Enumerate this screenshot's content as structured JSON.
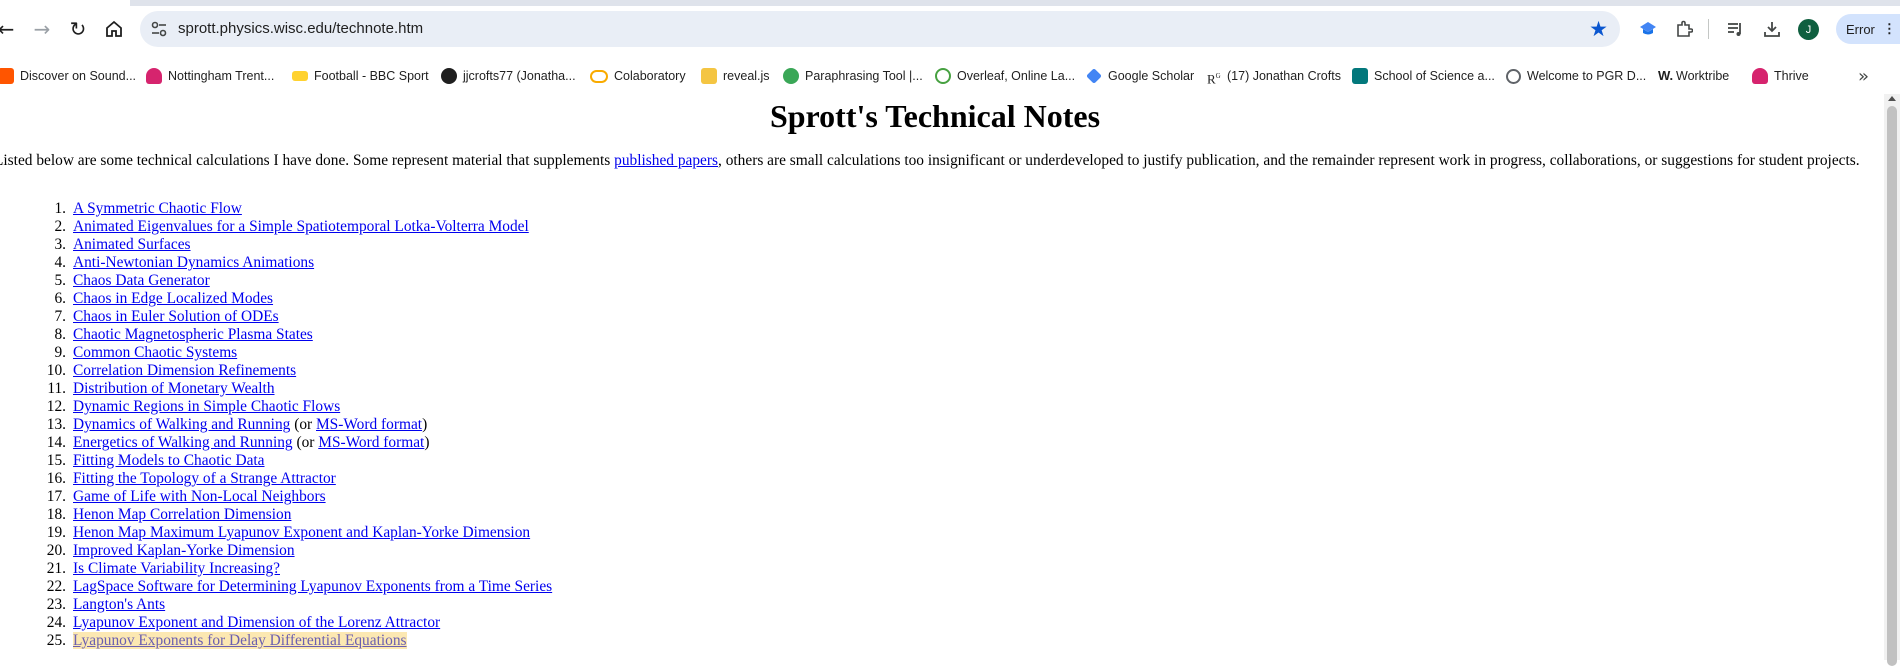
{
  "browser": {
    "url": "sprott.physics.wisc.edu/technote.htm",
    "profile_initial": "J",
    "error_label": "Error",
    "accent_color": "#0b57d0"
  },
  "bookmarks": [
    {
      "label": "Discover on Sound...",
      "icon": "soundcloud-icon"
    },
    {
      "label": "Nottingham Trent...",
      "icon": "ntu-icon"
    },
    {
      "label": "Football - BBC Sport",
      "icon": "bbc-sport-icon"
    },
    {
      "label": "jjcrofts77 (Jonatha...",
      "icon": "github-icon"
    },
    {
      "label": "Colaboratory",
      "icon": "colab-icon"
    },
    {
      "label": "reveal.js",
      "icon": "folder-icon"
    },
    {
      "label": "Paraphrasing Tool |...",
      "icon": "quillbot-icon"
    },
    {
      "label": "Overleaf, Online La...",
      "icon": "overleaf-icon"
    },
    {
      "label": "Google Scholar",
      "icon": "scholar-icon"
    },
    {
      "label": "(17) Jonathan Crofts",
      "icon": "researchgate-icon"
    },
    {
      "label": "School of Science a...",
      "icon": "sharepoint-icon"
    },
    {
      "label": "Welcome to PGR D...",
      "icon": "globe-icon"
    },
    {
      "label": "Worktribe",
      "icon": "worktribe-icon"
    },
    {
      "label": "Thrive",
      "icon": "ntu-icon"
    }
  ],
  "page": {
    "title": "Sprott's Technical Notes",
    "intro_before": "Listed below are some technical calculations I have done.  Some represent material that supplements ",
    "intro_link": "published papers",
    "intro_after": ", others are small calculations too insignificant or underdeveloped to justify publication, and the remainder represent work in progress, collaborations, or suggestions for student projects.",
    "or_text": "(or ",
    "close_paren": ")",
    "items": [
      {
        "num": "1.",
        "title": "A Symmetric Chaotic Flow"
      },
      {
        "num": "2.",
        "title": "Animated Eigenvalues for a Simple Spatiotemporal Lotka-Volterra Model"
      },
      {
        "num": "3.",
        "title": "Animated Surfaces"
      },
      {
        "num": "4.",
        "title": "Anti-Newtonian Dynamics Animations"
      },
      {
        "num": "5.",
        "title": "Chaos Data Generator"
      },
      {
        "num": "6.",
        "title": "Chaos in Edge Localized Modes"
      },
      {
        "num": "7.",
        "title": "Chaos in Euler Solution of ODEs"
      },
      {
        "num": "8.",
        "title": "Chaotic Magnetospheric Plasma States"
      },
      {
        "num": "9.",
        "title": "Common Chaotic Systems"
      },
      {
        "num": "10.",
        "title": "Correlation Dimension Refinements"
      },
      {
        "num": "11.",
        "title": "Distribution of Monetary Wealth"
      },
      {
        "num": "12.",
        "title": "Dynamic Regions in Simple Chaotic Flows"
      },
      {
        "num": "13.",
        "title": "Dynamics of Walking and Running",
        "alt": "MS-Word format"
      },
      {
        "num": "14.",
        "title": "Energetics of Walking and Running",
        "alt": "MS-Word format"
      },
      {
        "num": "15.",
        "title": "Fitting Models to Chaotic Data"
      },
      {
        "num": "16.",
        "title": "Fitting the Topology of a Strange Attractor"
      },
      {
        "num": "17.",
        "title": "Game of Life with Non-Local Neighbors"
      },
      {
        "num": "18.",
        "title": "Henon Map Correlation Dimension"
      },
      {
        "num": "19.",
        "title": "Henon Map Maximum Lyapunov Exponent and Kaplan-Yorke Dimension"
      },
      {
        "num": "20.",
        "title": "Improved Kaplan-Yorke Dimension"
      },
      {
        "num": "21.",
        "title": "Is Climate Variability Increasing?"
      },
      {
        "num": "22.",
        "title": "LagSpace Software for Determining Lyapunov Exponents from a Time Series"
      },
      {
        "num": "23.",
        "title": "Langton's Ants"
      },
      {
        "num": "24.",
        "title": "Lyapunov Exponent and Dimension of the Lorenz Attractor"
      },
      {
        "num": "25.",
        "title": "Lyapunov Exponents for Delay Differential Equations",
        "highlight": true
      }
    ]
  }
}
